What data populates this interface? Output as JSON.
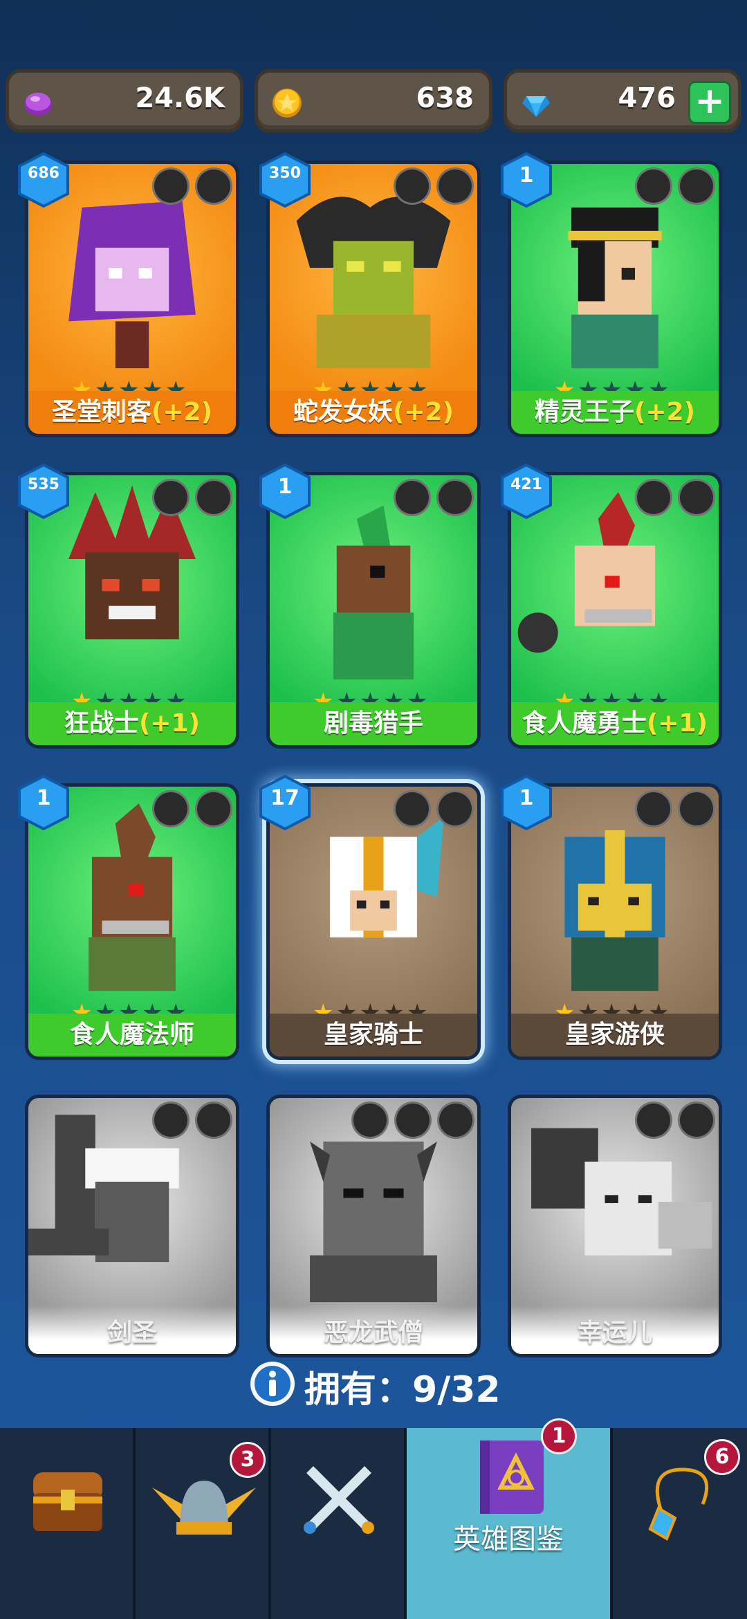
{
  "resources": {
    "gems_purple": "24.6K",
    "coins": "638",
    "diamonds": "476"
  },
  "cards": [
    {
      "name": "圣堂刺客",
      "bonus": "(+2)",
      "level": "686",
      "stars": 1,
      "color": "orange",
      "traits": [
        "wings-icon",
        "dagger-icon"
      ]
    },
    {
      "name": "蛇发女妖",
      "bonus": "(+2)",
      "level": "350",
      "stars": 1,
      "color": "orange",
      "traits": [
        "bow-icon",
        "skull-icon"
      ]
    },
    {
      "name": "精灵王子",
      "bonus": "(+2)",
      "level": "1",
      "stars": 1,
      "color": "green",
      "traits": [
        "elf-icon",
        "dagger-icon"
      ]
    },
    {
      "name": "狂战士",
      "bonus": "(+1)",
      "level": "535",
      "stars": 1,
      "color": "green",
      "traits": [
        "orc-icon",
        "sword-icon"
      ]
    },
    {
      "name": "剧毒猎手",
      "bonus": "",
      "level": "1",
      "stars": 1,
      "color": "green",
      "traits": [
        "orc-icon",
        "bow-icon"
      ]
    },
    {
      "name": "食人魔勇士",
      "bonus": "(+1)",
      "level": "421",
      "stars": 1,
      "color": "green",
      "traits": [
        "orc-icon",
        "sword-icon"
      ]
    },
    {
      "name": "食人魔法师",
      "bonus": "",
      "level": "1",
      "stars": 1,
      "color": "green",
      "traits": [
        "orc-icon",
        "staff-icon"
      ]
    },
    {
      "name": "皇家骑士",
      "bonus": "",
      "level": "17",
      "stars": 1,
      "color": "brown",
      "traits": [
        "helmet-icon",
        "sword-icon"
      ]
    },
    {
      "name": "皇家游侠",
      "bonus": "",
      "level": "1",
      "stars": 1,
      "color": "brown",
      "traits": [
        "helmet-icon",
        "bow-icon"
      ]
    },
    {
      "name": "剑圣",
      "bonus": "",
      "level": "",
      "stars": 0,
      "color": "gray",
      "traits": [
        "orc-icon",
        "sword-icon"
      ]
    },
    {
      "name": "恶龙武僧",
      "bonus": "",
      "level": "",
      "stars": 0,
      "color": "gray",
      "traits": [
        "skull-icon",
        "fist-icon",
        "dragon-icon"
      ]
    },
    {
      "name": "幸运儿",
      "bonus": "",
      "level": "",
      "stars": 0,
      "color": "gray",
      "traits": [
        "elf-icon",
        "fist-icon"
      ]
    }
  ],
  "owned": {
    "label": "拥有：",
    "count": "9/32"
  },
  "nav": {
    "items": [
      {
        "name": "chest",
        "badge": ""
      },
      {
        "name": "heroes",
        "badge": "3"
      },
      {
        "name": "battle",
        "badge": ""
      },
      {
        "name": "codex",
        "badge": "1",
        "label": "英雄图鉴"
      },
      {
        "name": "items",
        "badge": "6"
      }
    ]
  },
  "colors": {
    "orange": "#f38a12",
    "green": "#1dbf4c",
    "brown": "#8c7358",
    "bonus": "#ffe034",
    "badge": "#b6153c"
  }
}
